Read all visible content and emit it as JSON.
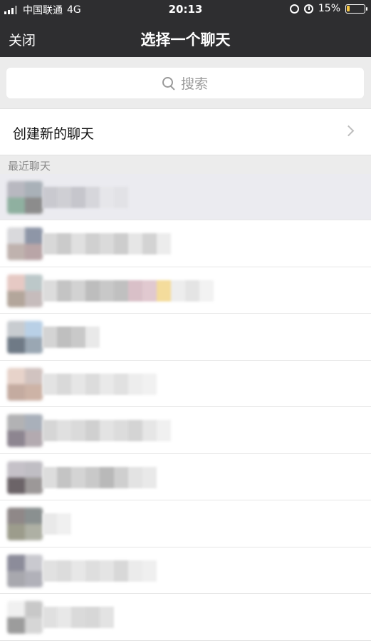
{
  "status_bar": {
    "carrier": "中国联通",
    "network": "4G",
    "time": "20:13",
    "battery": "15%",
    "battery_level": 0.15
  },
  "nav": {
    "close_label": "关闭",
    "title": "选择一个聊天"
  },
  "search": {
    "placeholder": "搜索"
  },
  "create_chat": {
    "label": "创建新的聊天"
  },
  "recent": {
    "header": "最近聊天",
    "items": [
      {
        "avatar": [
          "#b8b8c0",
          "#a9b1b8",
          "#8fb0a0",
          "#8c8c8c"
        ],
        "name_blocks": [
          "#c9c9cf",
          "#cfcfd4",
          "#c6c6cc",
          "#d6d6db",
          "#e6e6ea",
          "#e2e2e6"
        ]
      },
      {
        "avatar": [
          "#d9d9dc",
          "#8e96a7",
          "#bfb2ae",
          "#b9a5a7"
        ],
        "name_blocks": [
          "#d8d8d8",
          "#cbcbcb",
          "#e0e0e0",
          "#d0d0d0",
          "#dadada",
          "#cdcdcd",
          "#e6e6e6",
          "#d3d3d3",
          "#ececec"
        ]
      },
      {
        "avatar": [
          "#e6c9c4",
          "#bcc8c9",
          "#b3a69b",
          "#c6bcbc"
        ],
        "name_blocks": [
          "#dcdcdc",
          "#c4c4c4",
          "#d2d2d2",
          "#bdbdbd",
          "#c8c8c8",
          "#c0c0c0",
          "#d9c0c8",
          "#e1c9d0",
          "#f4dc9c",
          "#ededed",
          "#e4e4e4",
          "#f2f2f2"
        ]
      },
      {
        "avatar": [
          "#c8ccd0",
          "#b9d0e6",
          "#6f7a86",
          "#9aa7b3"
        ],
        "name_blocks": [
          "#d4d4d4",
          "#bfbfbf",
          "#c9c9c9",
          "#e9e9e9"
        ]
      },
      {
        "avatar": [
          "#e7d3ca",
          "#d1c3c0",
          "#c4aba0",
          "#cdb3a6"
        ],
        "name_blocks": [
          "#e3e3e3",
          "#d9d9d9",
          "#e6e6e6",
          "#dcdcdc",
          "#e9e9e9",
          "#e1e1e1",
          "#ededed",
          "#f1f1f1"
        ]
      },
      {
        "avatar": [
          "#b2b2b4",
          "#a9b0ba",
          "#8d8590",
          "#b3aab0"
        ],
        "name_blocks": [
          "#d6d6d6",
          "#e0e0e0",
          "#dadada",
          "#d0d0d0",
          "#e3e3e3",
          "#dcdcdc",
          "#d4d4d4",
          "#e6e6e6",
          "#f0f0f0"
        ]
      },
      {
        "avatar": [
          "#c5c1c8",
          "#c0bec4",
          "#6c6468",
          "#9c9898"
        ],
        "name_blocks": [
          "#dddddd",
          "#c4c4c4",
          "#d4d4d4",
          "#c9c9c9",
          "#b9b9b9",
          "#cfcfcf",
          "#e3e3e3",
          "#e9e9e9"
        ]
      },
      {
        "avatar": [
          "#8f8888",
          "#8a9090",
          "#9c9c8c",
          "#aeb0a4"
        ],
        "name_blocks": [
          "#e9e9e9",
          "#f0f0f0"
        ]
      },
      {
        "avatar": [
          "#8c8c9a",
          "#c9c9cf",
          "#a8a8ae",
          "#b1b1b9"
        ],
        "name_blocks": [
          "#e1e1e1",
          "#dcdcdc",
          "#e7e7e7",
          "#dedede",
          "#e4e4e4",
          "#d8d8d8",
          "#ebebeb",
          "#efefef"
        ]
      },
      {
        "avatar": [
          "#f0f0f0",
          "#c8c8c8",
          "#9c9c9c",
          "#d6d6d6"
        ],
        "name_blocks": [
          "#e0e0e0",
          "#e8e8e8",
          "#dadada",
          "#d7d7d7",
          "#e3e3e3"
        ]
      }
    ]
  },
  "colors": {
    "topbar": "#2e2e30",
    "background": "#ececec",
    "selected_row": "#ebebf0",
    "battery_low": "#f5c542"
  }
}
